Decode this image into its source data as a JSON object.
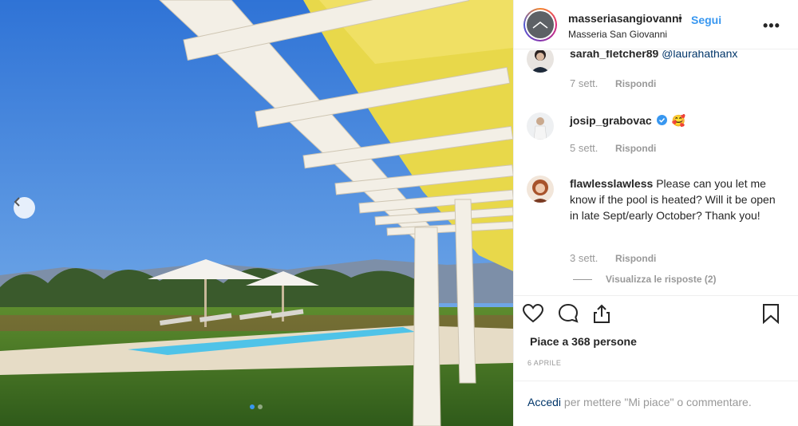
{
  "post": {
    "username": "masseriasangiovanni",
    "bullet": "•",
    "follow_label": "Segui",
    "location": "Masseria San Giovanni",
    "more_label": "•••"
  },
  "comments": [
    {
      "username": "sarah_fletcher89",
      "text": "@laurahathanx",
      "time": "7 sett.",
      "reply_label": "Rispondi"
    },
    {
      "username": "josip_grabovac",
      "text": "🥰",
      "time": "5 sett.",
      "reply_label": "Rispondi"
    },
    {
      "username": "flawlesslawless",
      "text": "Please can you let me know if the pool is heated? Will it be open in late Sept/early October? Thank you!",
      "time": "3 sett.",
      "reply_label": "Rispondi"
    }
  ],
  "view_replies": "Visualizza le risposte (2)",
  "likes": "Piace a 368 persone",
  "date": "6 APRILE",
  "footer": {
    "login": "Accedi",
    "rest": " per mettere \"Mi piace\" o commentare."
  },
  "carousel": {
    "current": 1,
    "total": 2
  },
  "icons": {
    "prev": "chevron-left-icon",
    "like": "heart-icon",
    "comment": "comment-bubble-icon",
    "share": "share-icon",
    "save": "bookmark-icon",
    "verified": "verified-badge-icon"
  },
  "colors": {
    "link": "#3897f0",
    "mention": "#003569",
    "meta": "#999999",
    "text": "#262626"
  }
}
